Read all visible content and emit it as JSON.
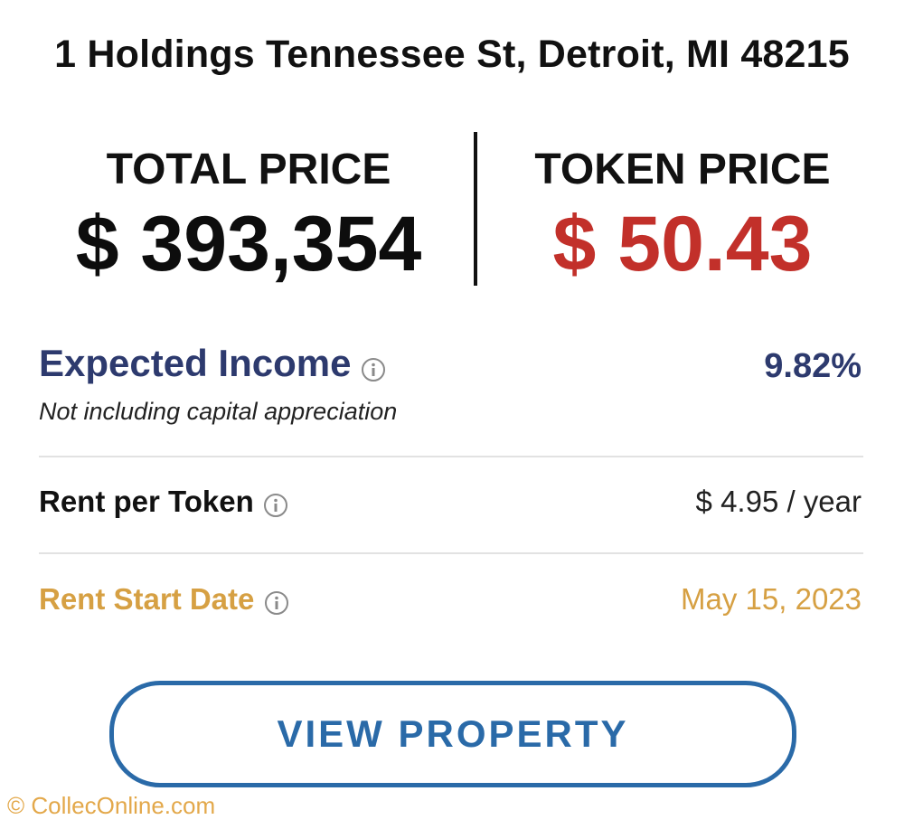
{
  "address": "1 Holdings Tennessee St, Detroit, MI 48215",
  "prices": {
    "total": {
      "label": "TOTAL PRICE",
      "value": "$ 393,354"
    },
    "token": {
      "label": "TOKEN PRICE",
      "value": "$ 50.43"
    }
  },
  "details": {
    "expected_income": {
      "label": "Expected Income",
      "value": "9.82%",
      "note": "Not including capital appreciation"
    },
    "rent_per_token": {
      "label": "Rent per Token",
      "value": "$ 4.95 / year"
    },
    "rent_start_date": {
      "label": "Rent Start Date",
      "value": "May 15, 2023"
    }
  },
  "actions": {
    "view_property_label": "VIEW PROPERTY"
  },
  "watermark": "© ColleсOnline.com",
  "icons": {
    "info": "info-circle-icon"
  },
  "colors": {
    "token_price": "#c2302a",
    "income": "#2d3a6e",
    "start_date": "#d6a043",
    "button": "#2a6aa8"
  }
}
